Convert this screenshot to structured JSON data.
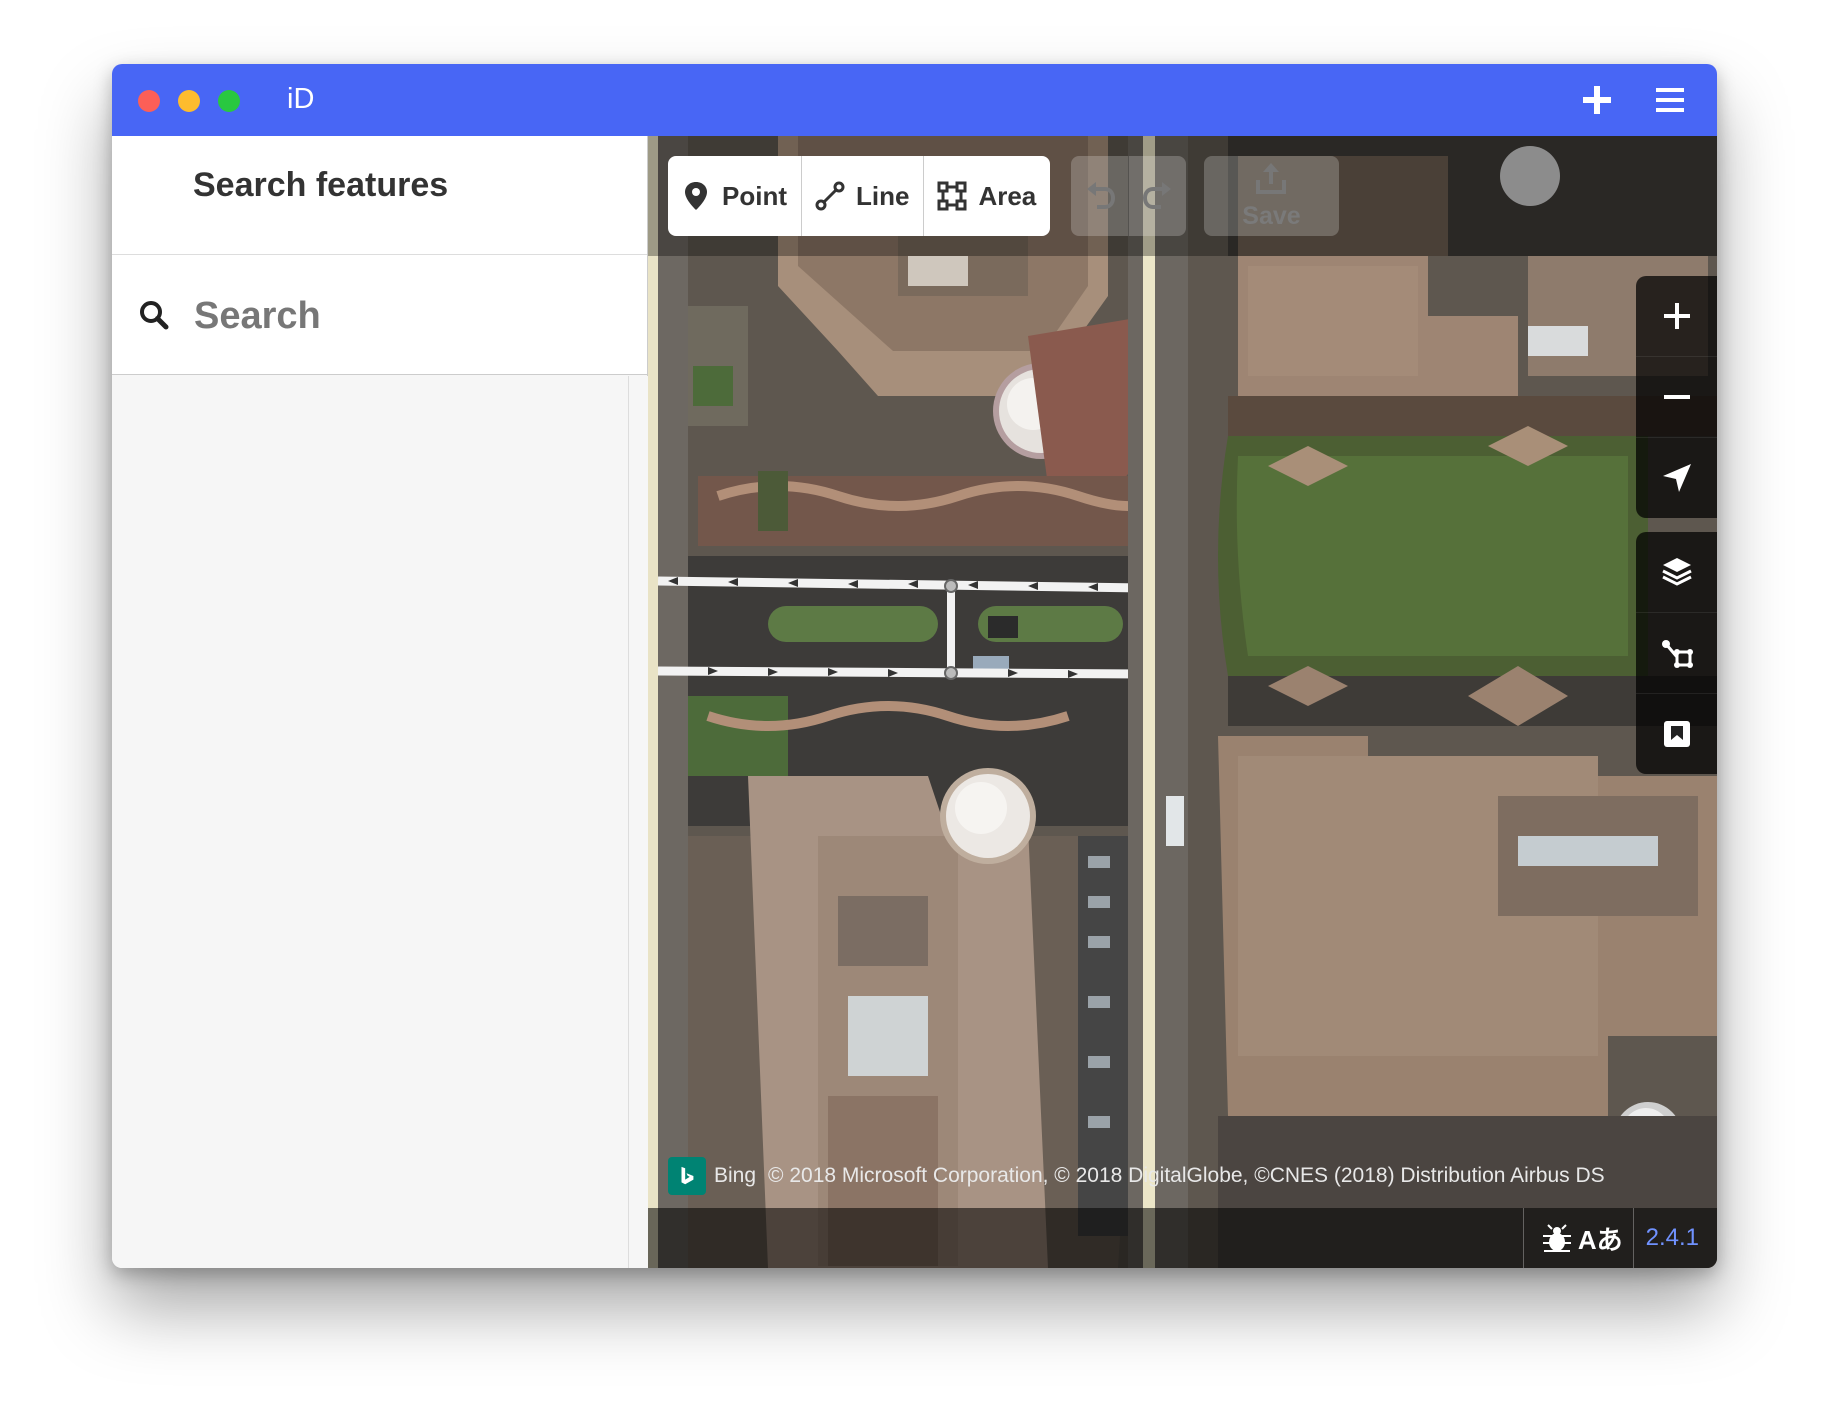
{
  "window": {
    "title": "iD",
    "accent_color": "#4866f5"
  },
  "titlebar": {
    "controls": [
      "close",
      "minimize",
      "zoom"
    ],
    "icons": [
      "plus-icon",
      "hamburger-menu-icon"
    ]
  },
  "sidebar": {
    "header_title": "Search features",
    "search": {
      "placeholder": "Search",
      "value": ""
    }
  },
  "toolbar": {
    "modes": [
      {
        "label": "Point",
        "icon": "map-pin-icon"
      },
      {
        "label": "Line",
        "icon": "line-icon"
      },
      {
        "label": "Area",
        "icon": "area-icon"
      }
    ],
    "undo_icon": "undo-icon",
    "redo_icon": "redo-icon",
    "save_label": "Save"
  },
  "map_controls": {
    "zoom": [
      "zoom-in-icon",
      "zoom-out-icon"
    ],
    "geolocate": "geolocate-icon",
    "panes": [
      "layers-icon",
      "map-data-icon",
      "issues-icon"
    ]
  },
  "attribution": {
    "provider": "Bing",
    "text": "© 2018 Microsoft Corporation, © 2018 DigitalGlobe, ©CNES (2018) Distribution Airbus DS"
  },
  "footer": {
    "version": "2.4.1",
    "icons": [
      "bug-report-icon",
      "language-icon"
    ],
    "language_label": "Aあ"
  }
}
